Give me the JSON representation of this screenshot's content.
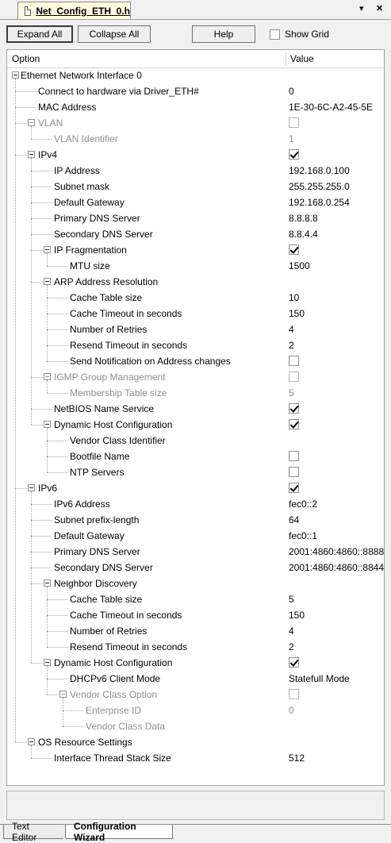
{
  "tab": {
    "title": "Net_Config_ETH_0.h"
  },
  "window_controls": {
    "pin": "▾",
    "close": "✕"
  },
  "toolbar": {
    "expand_all": "Expand All",
    "collapse_all": "Collapse All",
    "help": "Help",
    "show_grid": "Show Grid",
    "show_grid_checked": false
  },
  "columns": {
    "option": "Option",
    "value": "Value"
  },
  "tree": [
    {
      "level": 0,
      "label": "Ethernet Network Interface 0",
      "expander": true,
      "disabled": false
    },
    {
      "level": 1,
      "label": "Connect to hardware via Driver_ETH#",
      "value": "0",
      "disabled": false
    },
    {
      "level": 1,
      "label": "MAC Address",
      "value": "1E-30-6C-A2-45-5E",
      "disabled": false
    },
    {
      "level": 1,
      "label": "VLAN",
      "expander": true,
      "checkbox": false,
      "disabled": true
    },
    {
      "level": 2,
      "label": "VLAN Identifier",
      "value": "1",
      "disabled": true
    },
    {
      "level": 1,
      "label": "IPv4",
      "expander": true,
      "checkbox": true,
      "disabled": false
    },
    {
      "level": 2,
      "label": "IP Address",
      "value": "192.168.0.100",
      "disabled": false
    },
    {
      "level": 2,
      "label": "Subnet mask",
      "value": "255.255.255.0",
      "disabled": false
    },
    {
      "level": 2,
      "label": "Default Gateway",
      "value": "192.168.0.254",
      "disabled": false
    },
    {
      "level": 2,
      "label": "Primary DNS Server",
      "value": "8.8.8.8",
      "disabled": false
    },
    {
      "level": 2,
      "label": "Secondary DNS Server",
      "value": "8.8.4.4",
      "disabled": false
    },
    {
      "level": 2,
      "label": "IP Fragmentation",
      "expander": true,
      "checkbox": true,
      "disabled": false
    },
    {
      "level": 3,
      "label": "MTU size",
      "value": "1500",
      "disabled": false
    },
    {
      "level": 2,
      "label": "ARP Address Resolution",
      "expander": true,
      "disabled": false
    },
    {
      "level": 3,
      "label": "Cache Table size",
      "value": "10",
      "disabled": false
    },
    {
      "level": 3,
      "label": "Cache Timeout in seconds",
      "value": "150",
      "disabled": false
    },
    {
      "level": 3,
      "label": "Number of Retries",
      "value": "4",
      "disabled": false
    },
    {
      "level": 3,
      "label": "Resend Timeout in seconds",
      "value": "2",
      "disabled": false
    },
    {
      "level": 3,
      "label": "Send Notification on Address changes",
      "checkbox": false,
      "disabled": false
    },
    {
      "level": 2,
      "label": "IGMP Group Management",
      "expander": true,
      "checkbox": false,
      "disabled": true
    },
    {
      "level": 3,
      "label": "Membership Table size",
      "value": "5",
      "disabled": true
    },
    {
      "level": 2,
      "label": "NetBIOS Name Service",
      "checkbox": true,
      "disabled": false
    },
    {
      "level": 2,
      "label": "Dynamic Host Configuration",
      "expander": true,
      "checkbox": true,
      "disabled": false
    },
    {
      "level": 3,
      "label": "Vendor Class Identifier",
      "disabled": false
    },
    {
      "level": 3,
      "label": "Bootfile Name",
      "checkbox": false,
      "disabled": false
    },
    {
      "level": 3,
      "label": "NTP Servers",
      "checkbox": false,
      "disabled": false
    },
    {
      "level": 1,
      "label": "IPv6",
      "expander": true,
      "checkbox": true,
      "disabled": false
    },
    {
      "level": 2,
      "label": "IPv6 Address",
      "value": "fec0::2",
      "disabled": false
    },
    {
      "level": 2,
      "label": "Subnet prefix-length",
      "value": "64",
      "disabled": false
    },
    {
      "level": 2,
      "label": "Default Gateway",
      "value": "fec0::1",
      "disabled": false
    },
    {
      "level": 2,
      "label": "Primary DNS Server",
      "value": "2001:4860:4860::8888",
      "disabled": false
    },
    {
      "level": 2,
      "label": "Secondary DNS Server",
      "value": "2001:4860:4860::8844",
      "disabled": false
    },
    {
      "level": 2,
      "label": "Neighbor Discovery",
      "expander": true,
      "disabled": false
    },
    {
      "level": 3,
      "label": "Cache Table size",
      "value": "5",
      "disabled": false
    },
    {
      "level": 3,
      "label": "Cache Timeout in seconds",
      "value": "150",
      "disabled": false
    },
    {
      "level": 3,
      "label": "Number of Retries",
      "value": "4",
      "disabled": false
    },
    {
      "level": 3,
      "label": "Resend Timeout in seconds",
      "value": "2",
      "disabled": false
    },
    {
      "level": 2,
      "label": "Dynamic Host Configuration",
      "expander": true,
      "checkbox": true,
      "disabled": false
    },
    {
      "level": 3,
      "label": "DHCPv6 Client Mode",
      "value": "Statefull Mode",
      "disabled": false
    },
    {
      "level": 3,
      "label": "Vendor Class Option",
      "expander": true,
      "checkbox": false,
      "disabled": true
    },
    {
      "level": 4,
      "label": "Enterprise ID",
      "value": "0",
      "disabled": true
    },
    {
      "level": 4,
      "label": "Vendor Class Data",
      "disabled": true
    },
    {
      "level": 1,
      "label": "OS Resource Settings",
      "expander": true,
      "disabled": false
    },
    {
      "level": 2,
      "label": "Interface Thread Stack Size",
      "value": "512",
      "disabled": false
    }
  ],
  "bottom_tabs": {
    "text_editor": "Text Editor",
    "configuration_wizard": "Configuration Wizard"
  }
}
